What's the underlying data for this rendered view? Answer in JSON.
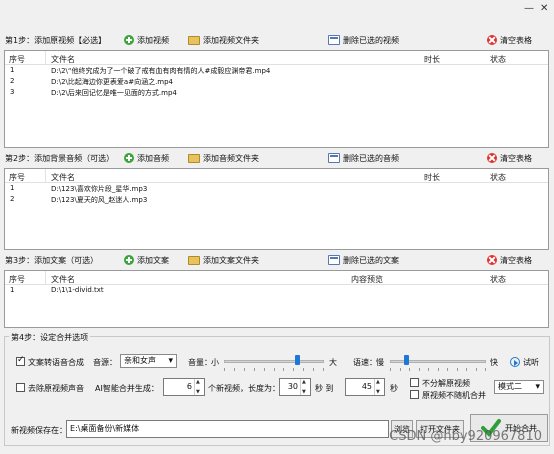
{
  "window": {
    "minimize_glyph": "—",
    "close_glyph": "✕"
  },
  "toolbar": {
    "add_label": "添加视频",
    "add_folder_label": "添加视频文件夹",
    "del_label": "删除已选的视频",
    "clear_label": "清空表格"
  },
  "step1": {
    "title": "第1步：添加原视频【必选】"
  },
  "table1": {
    "headers": {
      "num": "序号",
      "name": "文件名",
      "duration": "时长",
      "status": "状态"
    },
    "rows": [
      {
        "num": "1",
        "name": "D:\\2\\“他终究成为了一个破了戒有血有肉有情的人#成毅应渊帝君.mp4"
      },
      {
        "num": "2",
        "name": "D:\\2\\比起海边你更表爱a#向涵之.mp4"
      },
      {
        "num": "3",
        "name": "D:\\2\\后来回记忆是唯一见面的方式.mp4"
      }
    ]
  },
  "step2": {
    "title": "第2步：添加背景音频（可选）",
    "add_label": "添加音频",
    "add_folder_label": "添加音频文件夹",
    "del_label": "删除已选的音频",
    "clear_label": "清空表格"
  },
  "table2": {
    "headers": {
      "num": "序号",
      "name": "文件名",
      "duration": "时长",
      "status": "状态"
    },
    "rows": [
      {
        "num": "1",
        "name": "D:\\123\\喜欢你片段_星华.mp3"
      },
      {
        "num": "2",
        "name": "D:\\123\\夏天的风_赵迷人.mp3"
      }
    ]
  },
  "step3": {
    "title": "第3步：添加文案（可选）",
    "add_label": "添加文案",
    "add_folder_label": "添加文案文件夹",
    "del_label": "删除已选的文案",
    "clear_label": "清空表格"
  },
  "table3": {
    "headers": {
      "num": "序号",
      "name": "文件名",
      "preview": "内容预览",
      "status": "状态"
    },
    "rows": [
      {
        "num": "1",
        "name": "D:\\1\\1-divid.txt"
      }
    ]
  },
  "step4": {
    "title": "第4步：设定合并选项",
    "tts_label": "文案转语音合成",
    "tts_checked": true,
    "voice_label": "音源：",
    "voice_value": "亲和女声",
    "volume_label": "音量：",
    "volume_small": "小",
    "volume_big": "大",
    "volume_level": 0.75,
    "speed_label": "语速：",
    "speed_slow": "慢",
    "speed_fast": "快",
    "speed_level": 0.15,
    "listen_label": "试听",
    "remove_audio_label": "去除原视频声音",
    "remove_audio_checked": false,
    "ai_merge_label": "AI智能合并生成：",
    "count_value": "6",
    "count_suffix": "个新视频，长度为：",
    "min_len": "30",
    "to_label": "秒 到",
    "max_len": "45",
    "sec_label": "秒",
    "no_split_label": "不分解原视频",
    "no_random_label": "原视频不随机合并",
    "mode_value": "模式二",
    "save_label": "新视频保存在：",
    "save_path": "E:\\桌面备份\\新媒体",
    "browse_label": "浏览",
    "open_folder_label": "打开文件夹",
    "start_label": "开始合并"
  },
  "watermark": "CSDN @hby920967810",
  "colors": {
    "accent": "#1e78d7",
    "add_green": "#3aa53a",
    "clear_red": "#d33333"
  }
}
